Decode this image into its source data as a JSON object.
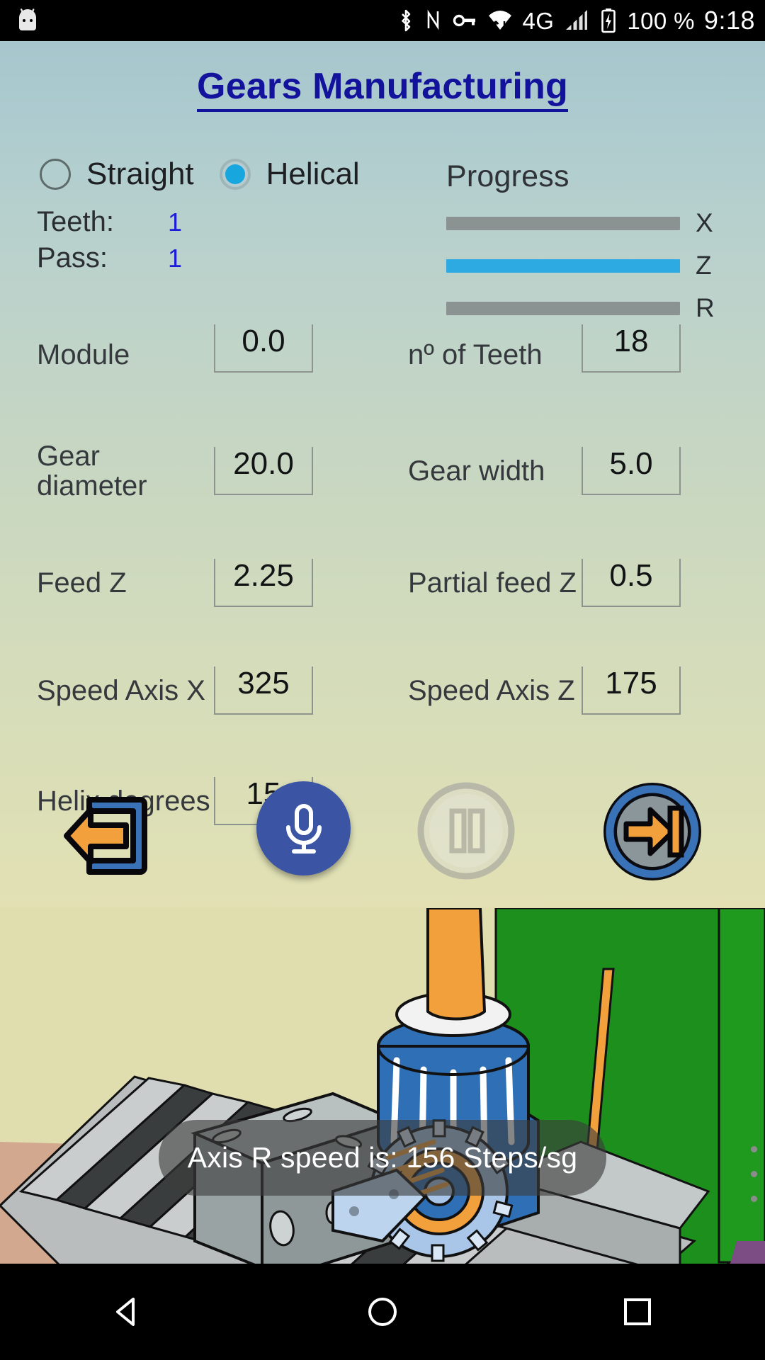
{
  "status_bar": {
    "icons": [
      "android-robot-icon",
      "bluetooth-icon",
      "nfc-icon",
      "vpn-key-icon",
      "wifi-icon",
      "signal-icon",
      "battery-charging-icon"
    ],
    "network_type": "4G",
    "battery_percent": "100 %",
    "clock": "9:18"
  },
  "header": {
    "title": "Gears Manufacturing"
  },
  "gear_type": {
    "options": [
      {
        "label": "Straight",
        "selected": false
      },
      {
        "label": "Helical",
        "selected": true
      }
    ]
  },
  "counters": [
    {
      "label": "Teeth:",
      "value": "1"
    },
    {
      "label": "Pass:",
      "value": "1"
    }
  ],
  "progress": {
    "title": "Progress",
    "bars": [
      {
        "axis": "X",
        "percent": 0
      },
      {
        "axis": "Z",
        "percent": 100
      },
      {
        "axis": "R",
        "percent": 0
      }
    ]
  },
  "fields": [
    {
      "label": "Module",
      "value": "0.0"
    },
    {
      "label": "nº of Teeth",
      "value": "18"
    },
    {
      "label": "Gear diameter",
      "value": "20.0"
    },
    {
      "label": "Gear width",
      "value": "5.0"
    },
    {
      "label": "Feed Z",
      "value": "2.25"
    },
    {
      "label": "Partial feed Z",
      "value": "0.5"
    },
    {
      "label": "Speed Axis X",
      "value": "325"
    },
    {
      "label": "Speed Axis Z",
      "value": "175"
    },
    {
      "label": "Helix degrees",
      "value": "15"
    }
  ],
  "buttons": [
    {
      "name": "exit-button",
      "icon": "exit-arrow-icon",
      "enabled": true
    },
    {
      "name": "voice-button",
      "icon": "microphone-icon",
      "enabled": true
    },
    {
      "name": "pause-button",
      "icon": "pause-icon",
      "enabled": false
    },
    {
      "name": "start-button",
      "icon": "start-to-end-icon",
      "enabled": true
    }
  ],
  "toast": {
    "message": "Axis R speed is: 156 Steps/sg"
  },
  "nav_bar": {
    "items": [
      "back-icon",
      "home-icon",
      "recents-icon"
    ]
  },
  "colors": {
    "title": "#12129c",
    "accent_blue": "#2eaae2",
    "value_blue": "#1b1bd8",
    "fab_blue": "#3b55a4",
    "progress_track": "#8a9392",
    "orange": "#f2a03c",
    "scene_green": "#1d8f1d"
  }
}
